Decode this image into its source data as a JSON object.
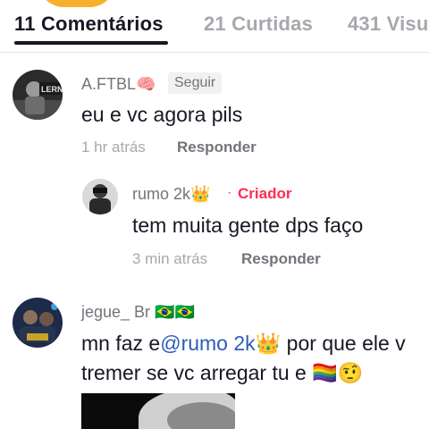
{
  "tabs": [
    {
      "label": "11 Comentários"
    },
    {
      "label": "21 Curtidas"
    },
    {
      "label": "431 Visu"
    }
  ],
  "comments": [
    {
      "username": "A.FTBL🧠",
      "follow_label": "Seguir",
      "text": "eu e vc agora pils",
      "time": "1 hr atrás",
      "reply_label": "Responder",
      "replies": [
        {
          "username": "rumo 2k👑",
          "separator": "·",
          "creator_label": "Criador",
          "text": "tem muita gente dps faço",
          "time": "3 min atrás",
          "reply_label": "Responder"
        }
      ]
    },
    {
      "username": "jegue_ Br 🇧🇷🇧🇷",
      "text_before": "mn faz e",
      "mention": "@rumo 2k👑",
      "text_after": " por que ele v",
      "text_line2": "tremer se vc arregar tu e 🏳️‍🌈🤨"
    }
  ],
  "colors": {
    "accent_red": "#fe2c55",
    "mention_blue": "#2b5db9",
    "primary_text": "#161823",
    "secondary_text": "#73747b",
    "muted_text": "#a7a8ad"
  }
}
